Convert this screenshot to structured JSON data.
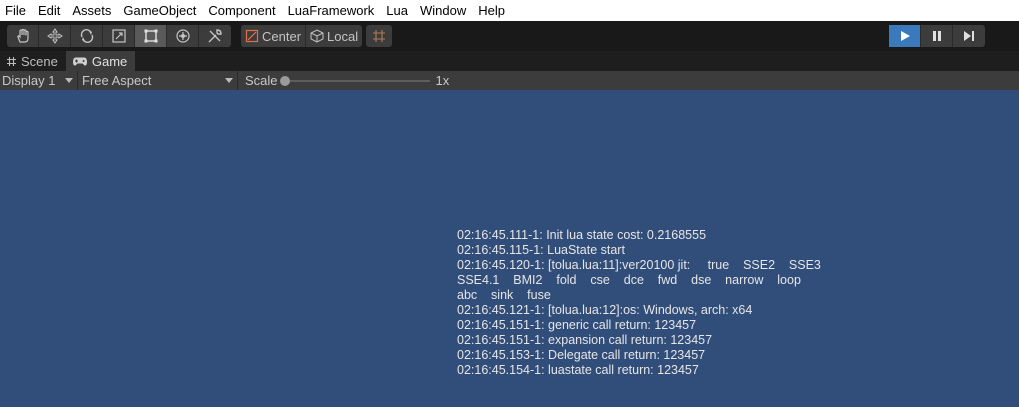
{
  "menu": [
    "File",
    "Edit",
    "Assets",
    "GameObject",
    "Component",
    "LuaFramework",
    "Lua",
    "Window",
    "Help"
  ],
  "toolbar": {
    "tools": [
      "hand-icon",
      "move-icon",
      "rotate-icon",
      "scale-icon",
      "rect-icon",
      "transform-icon",
      "custom-tool-icon"
    ],
    "active_tool": "rect-icon",
    "pivot_center": "Center",
    "pivot_local": "Local",
    "snap": "grid-snap-icon"
  },
  "playback": {
    "play": "play-icon",
    "pause": "pause-icon",
    "step": "step-icon",
    "play_color": "#3a79bb"
  },
  "tabs": [
    {
      "label": "Scene",
      "icon": "hash-icon",
      "active": false
    },
    {
      "label": "Game",
      "icon": "gamepad-icon",
      "active": true
    }
  ],
  "gamebar": {
    "display": "Display 1",
    "aspect": "Free Aspect",
    "scale_label": "Scale",
    "scale_value": "1x",
    "scale_level": 0
  },
  "viewport": {
    "background": "#314d79",
    "log_lines": [
      "02:16:45.111-1: Init lua state cost: 0.2168555",
      "02:16:45.115-1: LuaState start",
      "02:16:45.120-1: [tolua.lua:11]:ver20100 jit:     true    SSE2    SSE3",
      "SSE4.1    BMI2    fold    cse    dce    fwd    dse    narrow    loop",
      "abc    sink    fuse",
      "02:16:45.121-1: [tolua.lua:12]:os: Windows, arch: x64",
      "02:16:45.151-1: generic call return: 123457",
      "02:16:45.151-1: expansion call return: 123457",
      "02:16:45.153-1: Delegate call return: 123457",
      "02:16:45.154-1: luastate call return: 123457"
    ]
  }
}
